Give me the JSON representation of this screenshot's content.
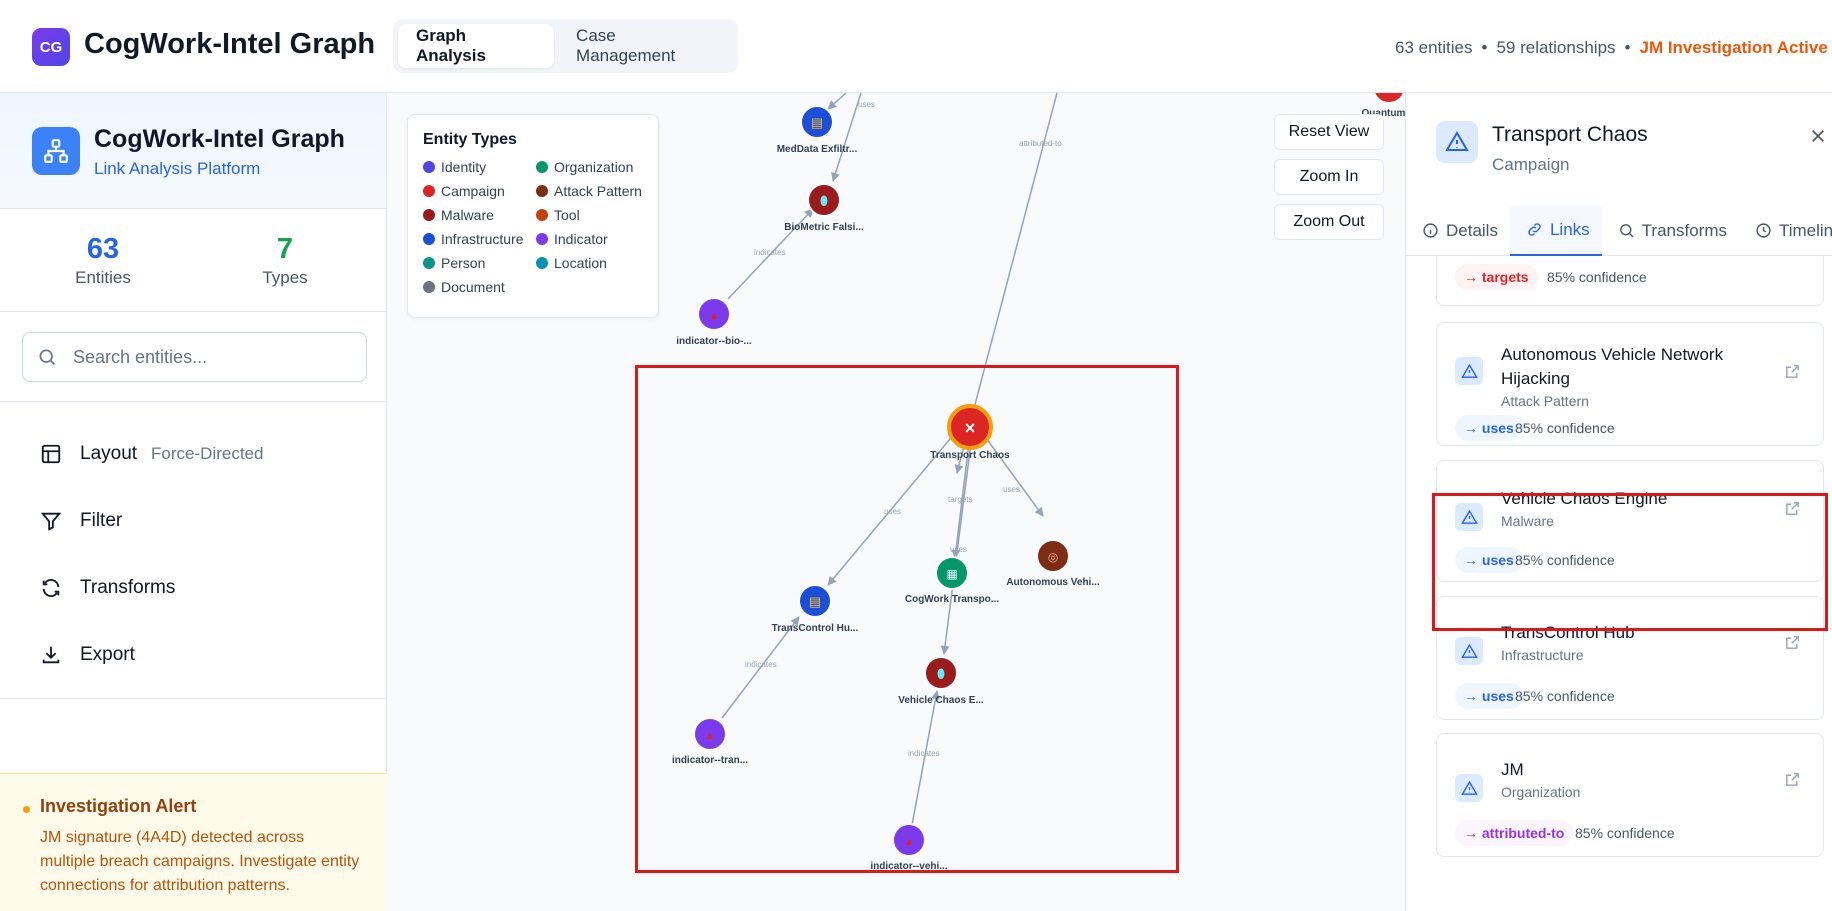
{
  "app": {
    "badge": "CG",
    "title": "CogWork-Intel Graph",
    "tabs": [
      "Graph Analysis",
      "Case Management"
    ],
    "entity_count": "63 entities",
    "relationship_count": "59 relationships",
    "investigation_status": "JM Investigation Active"
  },
  "sidebar": {
    "title": "CogWork-Intel Graph",
    "subtitle": "Link Analysis Platform",
    "stats": [
      {
        "value": "63",
        "label": "Entities",
        "color": "#2563eb"
      },
      {
        "value": "7",
        "label": "Types",
        "color": "#16a34a"
      }
    ],
    "search_placeholder": "Search entities...",
    "menu": [
      {
        "label": "Layout",
        "meta": "Force-Directed",
        "icon": "layout-icon"
      },
      {
        "label": "Filter",
        "meta": "",
        "icon": "filter-icon"
      },
      {
        "label": "Transforms",
        "meta": "",
        "icon": "refresh-icon"
      },
      {
        "label": "Export",
        "meta": "",
        "icon": "download-icon"
      }
    ],
    "alert": {
      "title": "Investigation Alert",
      "body": "JM signature (4A4D) detected across multiple breach campaigns. Investigate entity connections for attribution patterns."
    }
  },
  "legend": {
    "title": "Entity Types",
    "items": [
      {
        "label": "Identity",
        "color": "#4f46e5"
      },
      {
        "label": "Organization",
        "color": "#059669"
      },
      {
        "label": "Campaign",
        "color": "#dc2626"
      },
      {
        "label": "Attack Pattern",
        "color": "#7c2d12"
      },
      {
        "label": "Malware",
        "color": "#991b1b"
      },
      {
        "label": "Tool",
        "color": "#c2410c"
      },
      {
        "label": "Infrastructure",
        "color": "#1d4ed8"
      },
      {
        "label": "Indicator",
        "color": "#7c3aed"
      },
      {
        "label": "Person",
        "color": "#0d9488"
      },
      {
        "label": "Location",
        "color": "#0891b2"
      },
      {
        "label": "Document",
        "color": "#6b7280"
      }
    ]
  },
  "controls": [
    "Reset View",
    "Zoom In",
    "Zoom Out"
  ],
  "graph": {
    "nodes": [
      {
        "id": "medata",
        "label": "MedData Exfiltr...",
        "type": "Infrastructure",
        "color": "#1d4ed8",
        "glyph": "▤"
      },
      {
        "id": "biometric",
        "label": "BioMetric Falsi...",
        "type": "Malware",
        "color": "#991b1b",
        "glyph": "⬮"
      },
      {
        "id": "ind-bio",
        "label": "indicator--bio-...",
        "type": "Indicator",
        "color": "#7c3aed",
        "glyph": "▲"
      },
      {
        "id": "quantum",
        "label": "Quantum ...",
        "type": "Campaign",
        "color": "#dc2626",
        "glyph": ""
      },
      {
        "id": "transport",
        "label": "Transport Chaos",
        "type": "Campaign",
        "color": "#dc2626",
        "glyph": "✕"
      },
      {
        "id": "autonomous",
        "label": "Autonomous Vehi...",
        "type": "Attack Pattern",
        "color": "#7c2d12",
        "glyph": "◎"
      },
      {
        "id": "cogwork",
        "label": "CogWork Transpo...",
        "type": "Organization",
        "color": "#059669",
        "glyph": "▦"
      },
      {
        "id": "transcontrol",
        "label": "TransControl Hu...",
        "type": "Infrastructure",
        "color": "#1d4ed8",
        "glyph": "▤"
      },
      {
        "id": "vehicle",
        "label": "Vehicle Chaos E...",
        "type": "Malware",
        "color": "#991b1b",
        "glyph": "⬮"
      },
      {
        "id": "ind-tran",
        "label": "indicator--tran...",
        "type": "Indicator",
        "color": "#7c3aed",
        "glyph": "▲"
      },
      {
        "id": "ind-vehi",
        "label": "indicator--vehi...",
        "type": "Indicator",
        "color": "#7c3aed",
        "glyph": "▲"
      }
    ],
    "edges": [
      {
        "from": "offtop",
        "to": "medata",
        "label": "uses"
      },
      {
        "from": "offtop2",
        "to": "biometric",
        "label": ""
      },
      {
        "from": "ind-bio",
        "to": "biometric",
        "label": "indicates"
      },
      {
        "from": "offtop3",
        "to": "transport",
        "label": "attributed-to"
      },
      {
        "from": "transport",
        "to": "transcontrol",
        "label": "uses"
      },
      {
        "from": "transport",
        "to": "cogwork",
        "label": "targets"
      },
      {
        "from": "transport",
        "to": "autonomous",
        "label": "uses"
      },
      {
        "from": "transport",
        "to": "vehicle",
        "label": "uses"
      },
      {
        "from": "ind-tran",
        "to": "transcontrol",
        "label": "indicates"
      },
      {
        "from": "ind-vehi",
        "to": "vehicle",
        "label": "indicates"
      }
    ]
  },
  "panel": {
    "title": "Transport Chaos",
    "subtitle": "Campaign",
    "tabs": [
      "Details",
      "Links",
      "Transforms",
      "Timeline"
    ],
    "active_tab": "Links",
    "links": [
      {
        "name": "",
        "type": "",
        "rel": "→ targets",
        "rel_kind": "targets",
        "confidence": "85% confidence"
      },
      {
        "name": "Autonomous Vehicle Network Hijacking",
        "type": "Attack Pattern",
        "rel": "→ uses",
        "rel_kind": "uses",
        "confidence": "85% confidence"
      },
      {
        "name": "Vehicle Chaos Engine",
        "type": "Malware",
        "rel": "→ uses",
        "rel_kind": "uses",
        "confidence": "85% confidence"
      },
      {
        "name": "TransControl Hub",
        "type": "Infrastructure",
        "rel": "→ uses",
        "rel_kind": "uses",
        "confidence": "85% confidence"
      },
      {
        "name": "JM",
        "type": "Organization",
        "rel": "→ attributed-to",
        "rel_kind": "attributed-to",
        "confidence": "85% confidence"
      }
    ]
  }
}
